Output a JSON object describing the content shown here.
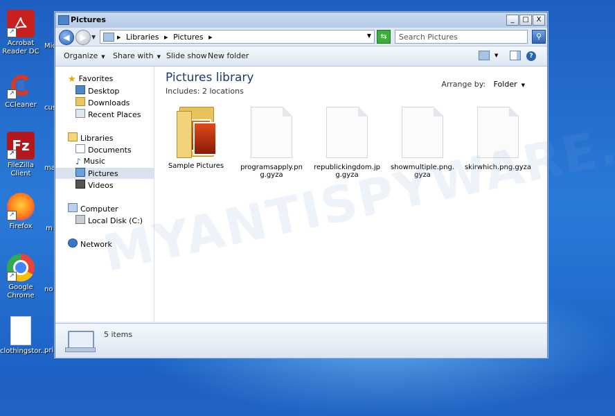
{
  "desktop": {
    "icons": [
      {
        "label": "Acrobat Reader DC",
        "icon": "acrobat-icon",
        "color": "#c8201e"
      },
      {
        "label": "CCleaner",
        "icon": "ccleaner-icon",
        "color": "#d83a24"
      },
      {
        "label": "FileZilla Client",
        "icon": "filezilla-icon",
        "color": "#b3181c"
      },
      {
        "label": "Firefox",
        "icon": "firefox-icon",
        "color": "#ff7a1a"
      },
      {
        "label": "Google Chrome",
        "icon": "chrome-icon",
        "color": "#4285f4"
      },
      {
        "label": "clothingstor...",
        "icon": "file-icon",
        "color": "#ffffff"
      }
    ],
    "peek_labels": [
      "Mic",
      "cus",
      "ma",
      "m",
      "no",
      "pri"
    ]
  },
  "window": {
    "title": "Pictures",
    "controls": {
      "minimize": "_",
      "maximize": "□",
      "close": "X"
    }
  },
  "address": {
    "crumbs": [
      "▸",
      "Libraries",
      "▸",
      "Pictures",
      "▸"
    ],
    "search_placeholder": "Search Pictures"
  },
  "toolbar": {
    "organize": "Organize",
    "share_with": "Share with",
    "slide_show": "Slide show",
    "new_folder": "New folder"
  },
  "navigation": {
    "favorites": "Favorites",
    "desktop": "Desktop",
    "downloads": "Downloads",
    "recent_places": "Recent Places",
    "libraries": "Libraries",
    "documents": "Documents",
    "music": "Music",
    "pictures": "Pictures",
    "videos": "Videos",
    "computer": "Computer",
    "local_disk": "Local Disk (C:)",
    "network": "Network"
  },
  "library": {
    "title": "Pictures library",
    "includes_label": "Includes:",
    "includes_value": "2 locations",
    "arrange_label": "Arrange by:",
    "arrange_value": "Folder"
  },
  "items": [
    {
      "name": "Sample Pictures",
      "type": "folder"
    },
    {
      "name": "programsapply.png.gyza",
      "type": "file"
    },
    {
      "name": "republickingdom.jpg.gyza",
      "type": "file"
    },
    {
      "name": "showmultiple.png.gyza",
      "type": "file"
    },
    {
      "name": "skirwhich.png.gyza",
      "type": "file"
    }
  ],
  "watermark": "MYANTISPYWARE.COM",
  "details": {
    "count": "5 items"
  }
}
